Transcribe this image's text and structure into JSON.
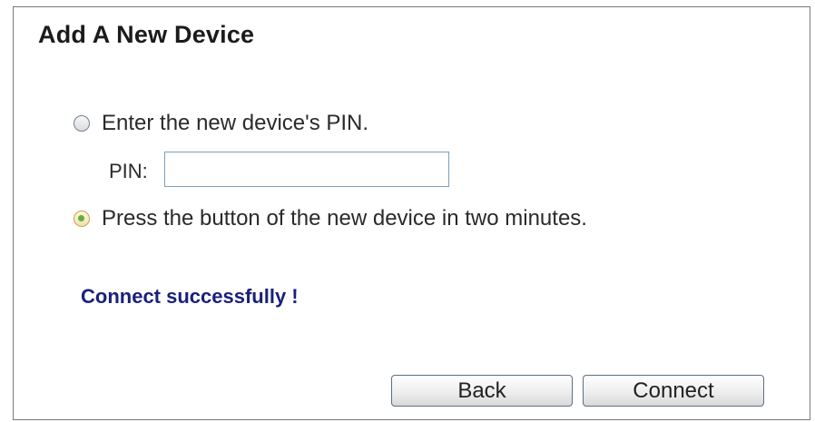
{
  "dialog": {
    "title": "Add A New Device",
    "option_pin_label": "Enter the new device's PIN.",
    "option_pin_selected": false,
    "pin_field_label": "PIN:",
    "pin_value": "",
    "option_button_label": "Press the button of the new device in two minutes.",
    "option_button_selected": true,
    "status_message": "Connect successfully !",
    "status_color": "#19217a",
    "back_label": "Back",
    "connect_label": "Connect"
  }
}
